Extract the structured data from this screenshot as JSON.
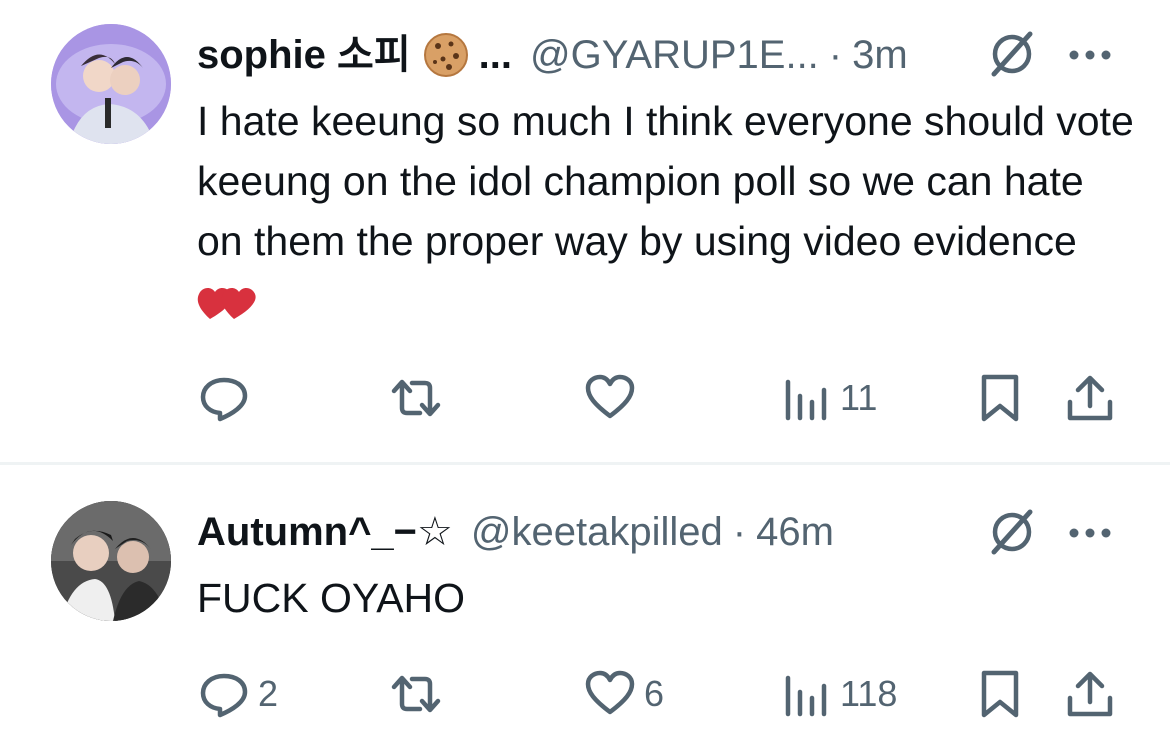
{
  "tweets": [
    {
      "display_name": "sophie 소피",
      "name_emoji": "cookie-emoji",
      "name_truncation": "...",
      "handle": "@GYARUP1E...",
      "separator": "·",
      "time": "3m",
      "text": "I hate keeung so much I think everyone should vote keeung on the idol champion poll so we can hate on them the proper way by using video evidence",
      "text_emoji": "two-red-hearts-emoji",
      "stats": {
        "replies": "",
        "reposts": "",
        "likes": "",
        "views": "11"
      }
    },
    {
      "display_name": "Autumn^_−☆",
      "handle": "@keetakpilled",
      "separator": "·",
      "time": "46m",
      "text": "FUCK OYAHO",
      "stats": {
        "replies": "2",
        "reposts": "",
        "likes": "6",
        "views": "118"
      }
    }
  ],
  "colors": {
    "text": "#0f1419",
    "secondary": "#536471",
    "divider": "#eff3f4",
    "heart_emoji": "#d8313e"
  }
}
